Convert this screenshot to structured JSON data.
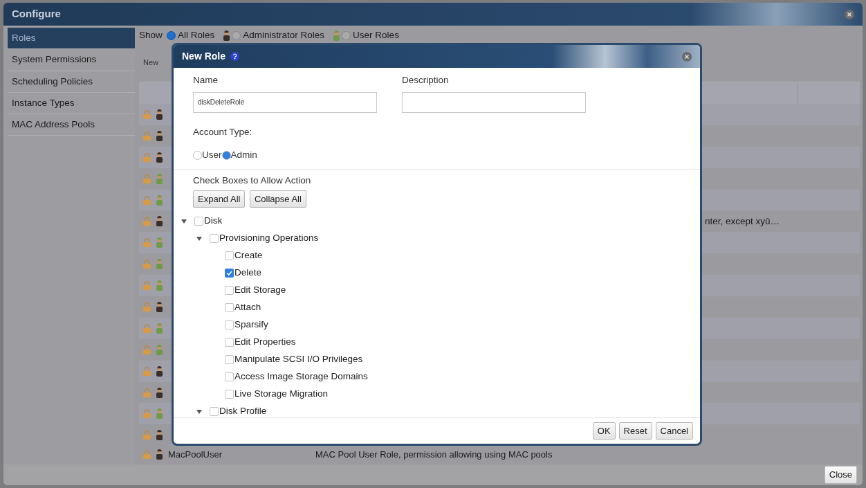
{
  "window": {
    "title": "Configure",
    "close_button": "Close"
  },
  "sidebar": {
    "items": [
      {
        "label": "Roles",
        "selected": true
      },
      {
        "label": "System Permissions",
        "selected": false
      },
      {
        "label": "Scheduling Policies",
        "selected": false
      },
      {
        "label": "Instance Types",
        "selected": false
      },
      {
        "label": "MAC Address Pools",
        "selected": false
      }
    ]
  },
  "filter": {
    "label": "Show",
    "options": [
      {
        "label": "All Roles",
        "selected": true,
        "kind": "all"
      },
      {
        "label": "Administrator Roles",
        "selected": false,
        "kind": "admin"
      },
      {
        "label": "User Roles",
        "selected": false,
        "kind": "user"
      }
    ]
  },
  "toolbar": {
    "new_button": "New"
  },
  "table": {
    "rows": [
      {
        "kind": "admin",
        "text": ""
      },
      {
        "kind": "admin",
        "text": ""
      },
      {
        "kind": "admin",
        "text": ""
      },
      {
        "kind": "user",
        "text": ""
      },
      {
        "kind": "user",
        "text": ""
      },
      {
        "kind": "admin",
        "text": "nter, except xyû…"
      },
      {
        "kind": "user",
        "text": ""
      },
      {
        "kind": "user",
        "text": ""
      },
      {
        "kind": "user",
        "text": ""
      },
      {
        "kind": "admin",
        "text": ""
      },
      {
        "kind": "user",
        "text": ""
      },
      {
        "kind": "user",
        "text": ""
      },
      {
        "kind": "admin",
        "text": ""
      },
      {
        "kind": "admin",
        "text": ""
      },
      {
        "kind": "user",
        "text": ""
      },
      {
        "kind": "admin",
        "text": ""
      }
    ],
    "last_row": {
      "kind": "admin",
      "name": "MacPoolUser",
      "description": "MAC Pool User Role, permission allowing using MAC pools"
    }
  },
  "dialog": {
    "title": "New Role",
    "name": {
      "label": "Name",
      "value": "diskDeleteRole"
    },
    "description": {
      "label": "Description"
    },
    "account_type": {
      "label": "Account Type:",
      "options": [
        {
          "label": "User",
          "selected": false
        },
        {
          "label": "Admin",
          "selected": true
        }
      ]
    },
    "permissions_label": "Check Boxes to Allow Action",
    "expand_button": "Expand All",
    "collapse_button": "Collapse All",
    "tree": [
      {
        "label": "Disk",
        "checked": false,
        "expanded": true,
        "children": [
          {
            "label": "Provisioning Operations",
            "checked": false,
            "expanded": true,
            "children": [
              {
                "label": "Create",
                "checked": false
              },
              {
                "label": "Delete",
                "checked": true
              },
              {
                "label": "Edit Storage",
                "checked": false
              },
              {
                "label": "Attach",
                "checked": false
              },
              {
                "label": "Sparsify",
                "checked": false
              },
              {
                "label": "Edit Properties",
                "checked": false
              },
              {
                "label": "Manipulate SCSI I/O Privileges",
                "checked": false
              },
              {
                "label": "Access Image Storage Domains",
                "checked": false
              },
              {
                "label": "Live Storage Migration",
                "checked": false
              }
            ]
          },
          {
            "label": "Disk Profile",
            "checked": false,
            "expanded": true
          }
        ]
      }
    ],
    "buttons": [
      "OK",
      "Reset",
      "Cancel"
    ]
  }
}
